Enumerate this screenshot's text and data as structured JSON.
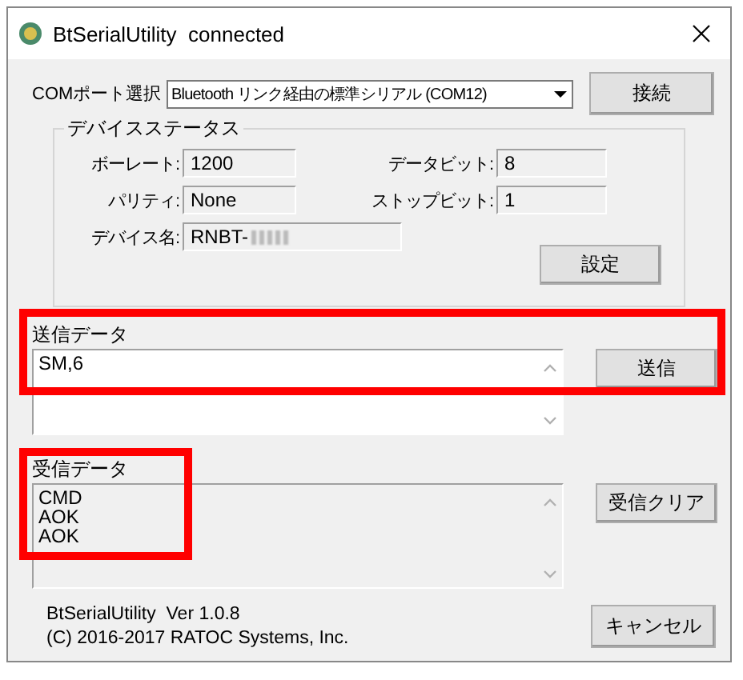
{
  "window": {
    "title": "BtSerialUtility  connected"
  },
  "com_port": {
    "label": "COMポート選択",
    "value": "Bluetooth リンク経由の標準シリアル (COM12)"
  },
  "connect_button": "接続",
  "device_status": {
    "title": "デバイスステータス",
    "fields": [
      {
        "label": "ボーレート:",
        "value": "1200"
      },
      {
        "label": "データビット:",
        "value": "8"
      },
      {
        "label": "パリティ:",
        "value": "None"
      },
      {
        "label": "ストップビット:",
        "value": "1"
      },
      {
        "label": "デバイス名:",
        "value": "RNBT-",
        "blurred": true
      }
    ],
    "settings_button": "設定"
  },
  "send": {
    "label": "送信データ",
    "value": "SM,6",
    "button": "送信"
  },
  "receive": {
    "label": "受信データ",
    "lines": [
      "CMD",
      "AOK",
      "AOK"
    ],
    "button": "受信クリア"
  },
  "footer": {
    "lines": [
      "BtSerialUtility  Ver 1.0.8",
      "(C) 2016-2017 RATOC Systems, Inc."
    ]
  },
  "cancel_button": "キャンセル"
}
